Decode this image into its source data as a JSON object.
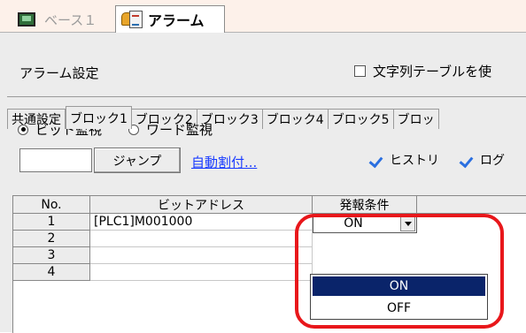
{
  "doc_tabs": [
    {
      "label": "ベース１"
    },
    {
      "label": "アラーム"
    }
  ],
  "panel": {
    "title": "アラーム設定",
    "string_table_checkbox": "文字列テーブルを使"
  },
  "block_tabs": [
    "共通設定",
    "ブロック1",
    "ブロック2",
    "ブロック3",
    "ブロック4",
    "ブロック5",
    "ブロッ"
  ],
  "monitor": {
    "bit_label": "ビット監視",
    "word_label": "ワード監視"
  },
  "toolbar": {
    "address_value": "",
    "jump_label": "ジャンプ",
    "auto_assign_label": "自動割付...",
    "history_label": "ヒストリ",
    "log_label": "ログ"
  },
  "table": {
    "headers": [
      "No.",
      "ビットアドレス",
      "発報条件"
    ],
    "rows": [
      {
        "no": "1",
        "address": "[PLC1]M001000",
        "condition": "ON"
      },
      {
        "no": "2",
        "address": "",
        "condition": ""
      },
      {
        "no": "3",
        "address": "",
        "condition": ""
      },
      {
        "no": "4",
        "address": "",
        "condition": ""
      }
    ]
  },
  "dropdown": {
    "value": "ON",
    "options": [
      "ON",
      "OFF"
    ],
    "selected": "ON"
  },
  "colors": {
    "highlight": "#e8171b",
    "selection": "#0a246a",
    "link": "#1a3cff",
    "check": "#2a6fe0"
  }
}
